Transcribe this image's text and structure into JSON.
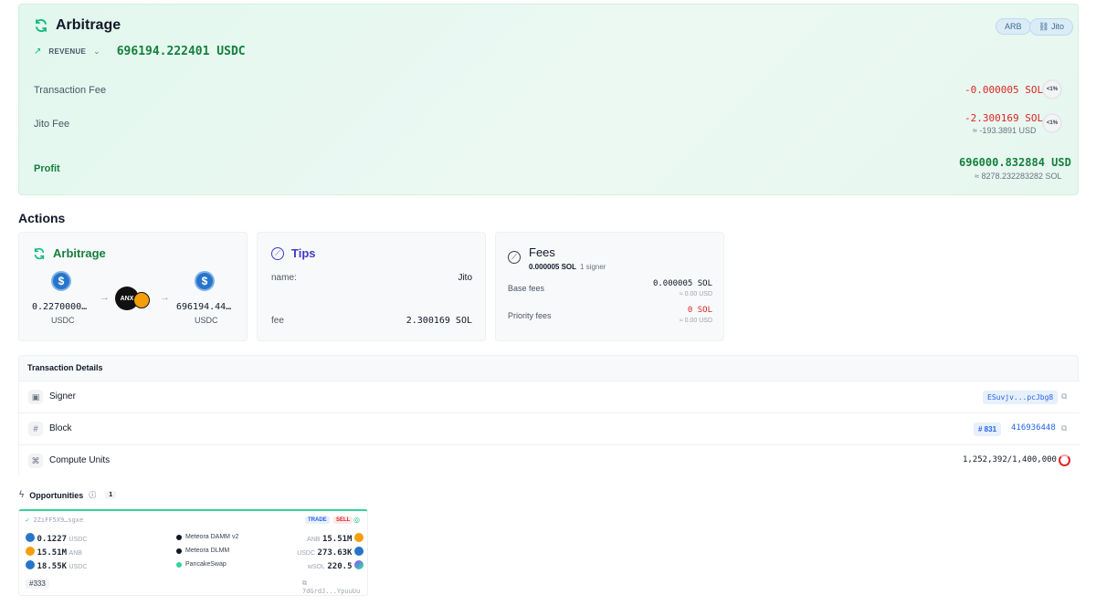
{
  "hero": {
    "title": "Arbitrage",
    "badges": [
      "ARB",
      "Jito"
    ],
    "revenue_label": "REVENUE",
    "revenue_amount": "696194.222401 USDC",
    "rows": [
      {
        "label": "Transaction Fee",
        "value": "-0.000005 SOL",
        "pct": "<1%"
      },
      {
        "label": "Jito Fee",
        "value": "-2.300169 SOL",
        "sub": "≈ -193.3891 USD",
        "pct": "<1%"
      }
    ],
    "profit_label": "Profit",
    "profit_amount": "696000.832884 USD",
    "profit_sub": "≈ 8278.232283282 SOL"
  },
  "actions_title": "Actions",
  "arb_card": {
    "title": "Arbitrage",
    "from_amount": "0.2270000…",
    "from_unit": "USDC",
    "mid_label": "ANX",
    "to_amount": "696194.44…",
    "to_unit": "USDC"
  },
  "tips_card": {
    "title": "Tips",
    "name_label": "name:",
    "name_value": "Jito",
    "fee_label": "fee",
    "fee_value": "2.300169 SOL"
  },
  "fees_card": {
    "title": "Fees",
    "summary_amount": "0.000005 SOL",
    "summary_signers": "1 signer",
    "base_label": "Base fees",
    "base_value": "0.000005 SOL",
    "base_sub": "≈ 0.00 USD",
    "priority_label": "Priority fees",
    "priority_value": "0 SOL",
    "priority_sub": "≈ 0.00 USD"
  },
  "details": {
    "title": "Transaction Details",
    "signer_label": "Signer",
    "signer_value": "ESuvjv...pcJbg8",
    "block_label": "Block",
    "block_badge": "# 831",
    "block_value": "416936448",
    "compute_label": "Compute Units",
    "compute_value": "1,252,392/1,400,000"
  },
  "opportunities": {
    "title": "Opportunities",
    "count": "1",
    "id": "2ZiFF5X9…sgxe",
    "tag_trade": "TRADE",
    "tag_sell": "SELL",
    "rows": [
      {
        "in_amount": "0.1227",
        "in_unit": "USDC",
        "dex": "Meteora DAMM v2",
        "out_unit": "ANB",
        "out_amount": "15.51M"
      },
      {
        "in_amount": "15.51M",
        "in_unit": "ANB",
        "dex": "Meteora DLMM",
        "out_unit": "USDC",
        "out_amount": "273.63K"
      },
      {
        "in_amount": "18.55K",
        "in_unit": "USDC",
        "dex": "PancakeSwap",
        "out_unit": "wSOL",
        "out_amount": "220.5"
      }
    ],
    "footer_badge": "#333",
    "footer_addr": "7dGrdJ...YpuuUu"
  }
}
